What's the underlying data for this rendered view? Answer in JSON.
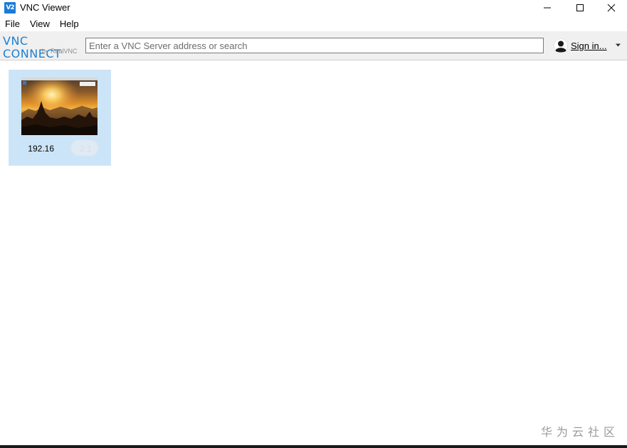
{
  "window": {
    "app_icon_text": "V2",
    "title": "VNC Viewer"
  },
  "menu": {
    "items": [
      "File",
      "View",
      "Help"
    ]
  },
  "toolbar": {
    "logo_main": "VNC CONNECT",
    "logo_sub": "by RealVNC",
    "search_placeholder": "Enter a VNC Server address or search",
    "search_value": "",
    "signin_label": "Sign in..."
  },
  "connections": [
    {
      "label": "192.168.x.x:1",
      "label_visible": "192.16▒▒▒▒2:1",
      "selected": true
    }
  ],
  "watermark": "华为云社区",
  "colors": {
    "accent": "#1d7fd2",
    "tile_selected_bg": "#cce4f7",
    "toolbar_bg": "#f0f0f0"
  }
}
